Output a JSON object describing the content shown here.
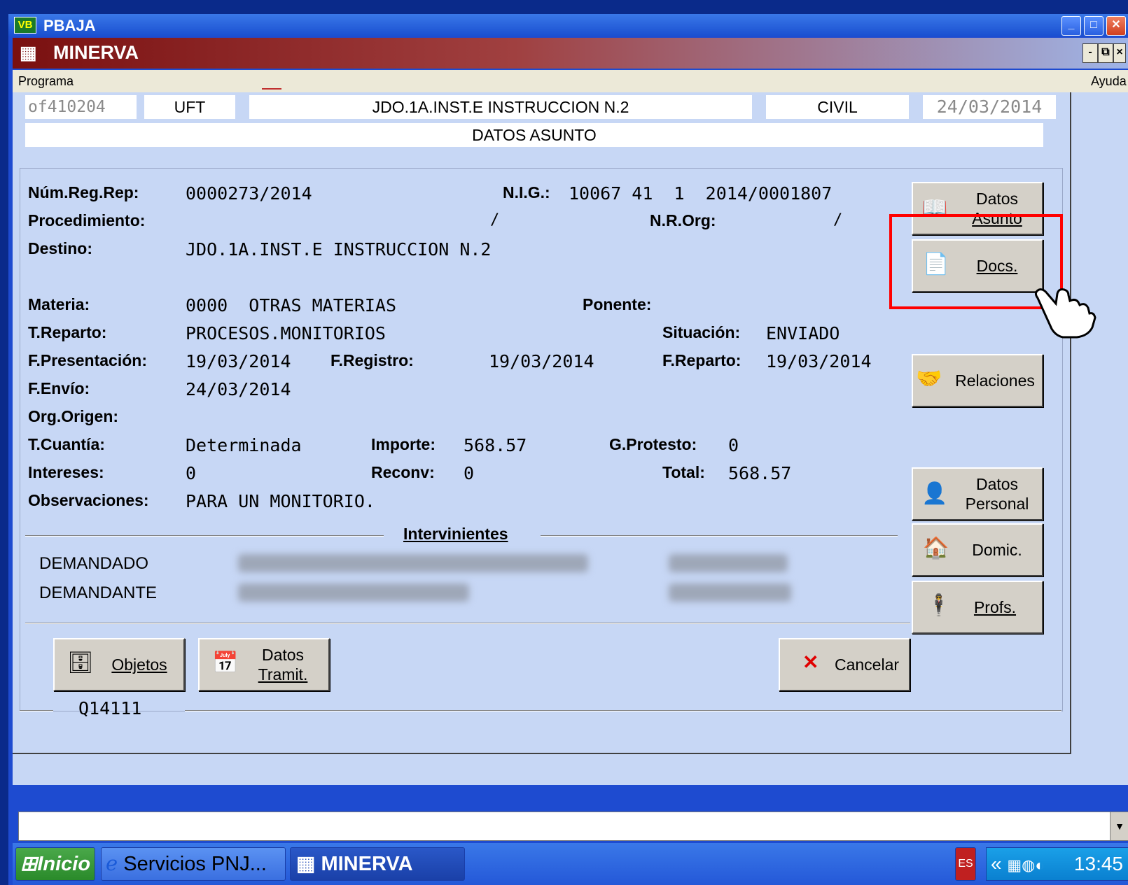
{
  "window": {
    "title": "PBAJA",
    "badge": "VB",
    "min": "_",
    "max": "□",
    "close": "✕"
  },
  "app": {
    "title": "MINERVA",
    "icon": "▦"
  },
  "menu": {
    "programa": "Programa",
    "ayuda": "Ayuda"
  },
  "header": {
    "code": "of410204",
    "unit": "UFT",
    "court": "JDO.1A.INST.E INSTRUCCION N.2",
    "type": "CIVIL",
    "date": "24/03/2014",
    "section": "DATOS ASUNTO"
  },
  "form": {
    "num_reg_rep_label": "Núm.Reg.Rep:",
    "num_reg_rep": "0000273/2014",
    "nig_label": "N.I.G.:",
    "nig": "10067 41  1  2014/0001807",
    "procedimiento_label": "Procedimiento:",
    "procedimiento": "/",
    "nr_org_label": "N.R.Org:",
    "nr_org": "/",
    "destino_label": "Destino:",
    "destino": "JDO.1A.INST.E INSTRUCCION N.2",
    "materia_label": "Materia:",
    "materia": "0000  OTRAS MATERIAS",
    "ponente_label": "Ponente:",
    "treparto_label": "T.Reparto:",
    "treparto": "PROCESOS.MONITORIOS",
    "situacion_label": "Situación:",
    "situacion": "ENVIADO",
    "fpresentacion_label": "F.Presentación:",
    "fpresentacion": "19/03/2014",
    "fregistro_label": "F.Registro:",
    "fregistro": "19/03/2014",
    "freparto_label": "F.Reparto:",
    "freparto": "19/03/2014",
    "fenvio_label": "F.Envío:",
    "fenvio": "24/03/2014",
    "orgorigen_label": "Org.Origen:",
    "tcuantia_label": "T.Cuantía:",
    "tcuantia": "Determinada",
    "importe_label": "Importe:",
    "importe": "568.57",
    "gprotesto_label": "G.Protesto:",
    "gprotesto": "0",
    "intereses_label": "Intereses:",
    "intereses": "0",
    "reconv_label": "Reconv:",
    "reconv": "0",
    "total_label": "Total:",
    "total": "568.57",
    "observaciones_label": "Observaciones:",
    "observaciones": "PARA UN MONITORIO."
  },
  "intervinientes": {
    "title": "Intervinientes",
    "rows": [
      {
        "role": "DEMANDADO"
      },
      {
        "role": "DEMANDANTE"
      }
    ]
  },
  "buttons": {
    "datos_asunto_1": "Datos",
    "datos_asunto_2": "Asunto",
    "docs": "Docs.",
    "relaciones": "Relaciones",
    "datos_personal_1": "Datos",
    "datos_personal_2": "Personal",
    "domic": "Domic.",
    "profs": "Profs.",
    "objetos": "Objetos",
    "datos_tramit_1": "Datos",
    "datos_tramit_2": "Tramit.",
    "cancelar": "Cancelar"
  },
  "footer_code": "Q14111",
  "taskbar": {
    "start": "Inicio",
    "item1": "Servicios PNJ...",
    "item2": "MINERVA",
    "lang": "ES",
    "chevron": "«",
    "time": "13:45"
  },
  "colors": {
    "highlight": "#ff0000",
    "content_bg": "#c7d7f5",
    "title_red": "#7a1010"
  }
}
